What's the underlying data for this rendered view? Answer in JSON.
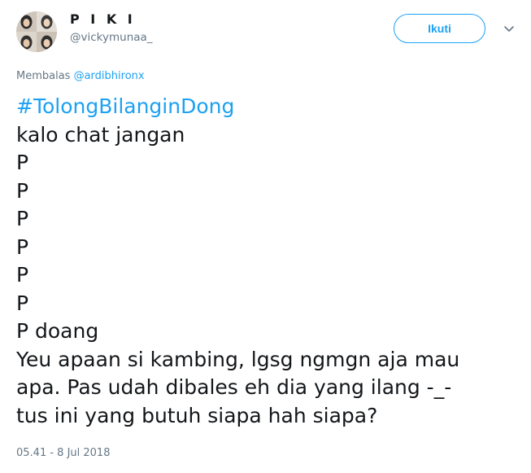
{
  "author": {
    "display_name": "P I K I",
    "handle": "@vickymunaa_"
  },
  "follow_button": {
    "label": "Ikuti"
  },
  "menu": {
    "icon": "chevron-down-icon"
  },
  "reply": {
    "prefix": "Membalas",
    "target": "@ardibhironx"
  },
  "tweet": {
    "hashtag": "#TolongBilanginDong",
    "lines": [
      "kalo chat jangan",
      "P",
      "P",
      "P",
      "P",
      "P",
      "P",
      "P doang",
      "Yeu apaan si kambing, lgsg ngmgn aja mau",
      "apa. Pas udah dibales eh dia yang ilang -_-",
      "tus ini yang butuh siapa hah siapa?"
    ]
  },
  "timestamp": "05.41 - 8 Jul 2018",
  "colors": {
    "accent": "#1da1f2",
    "text": "#14171a",
    "muted": "#657786"
  }
}
